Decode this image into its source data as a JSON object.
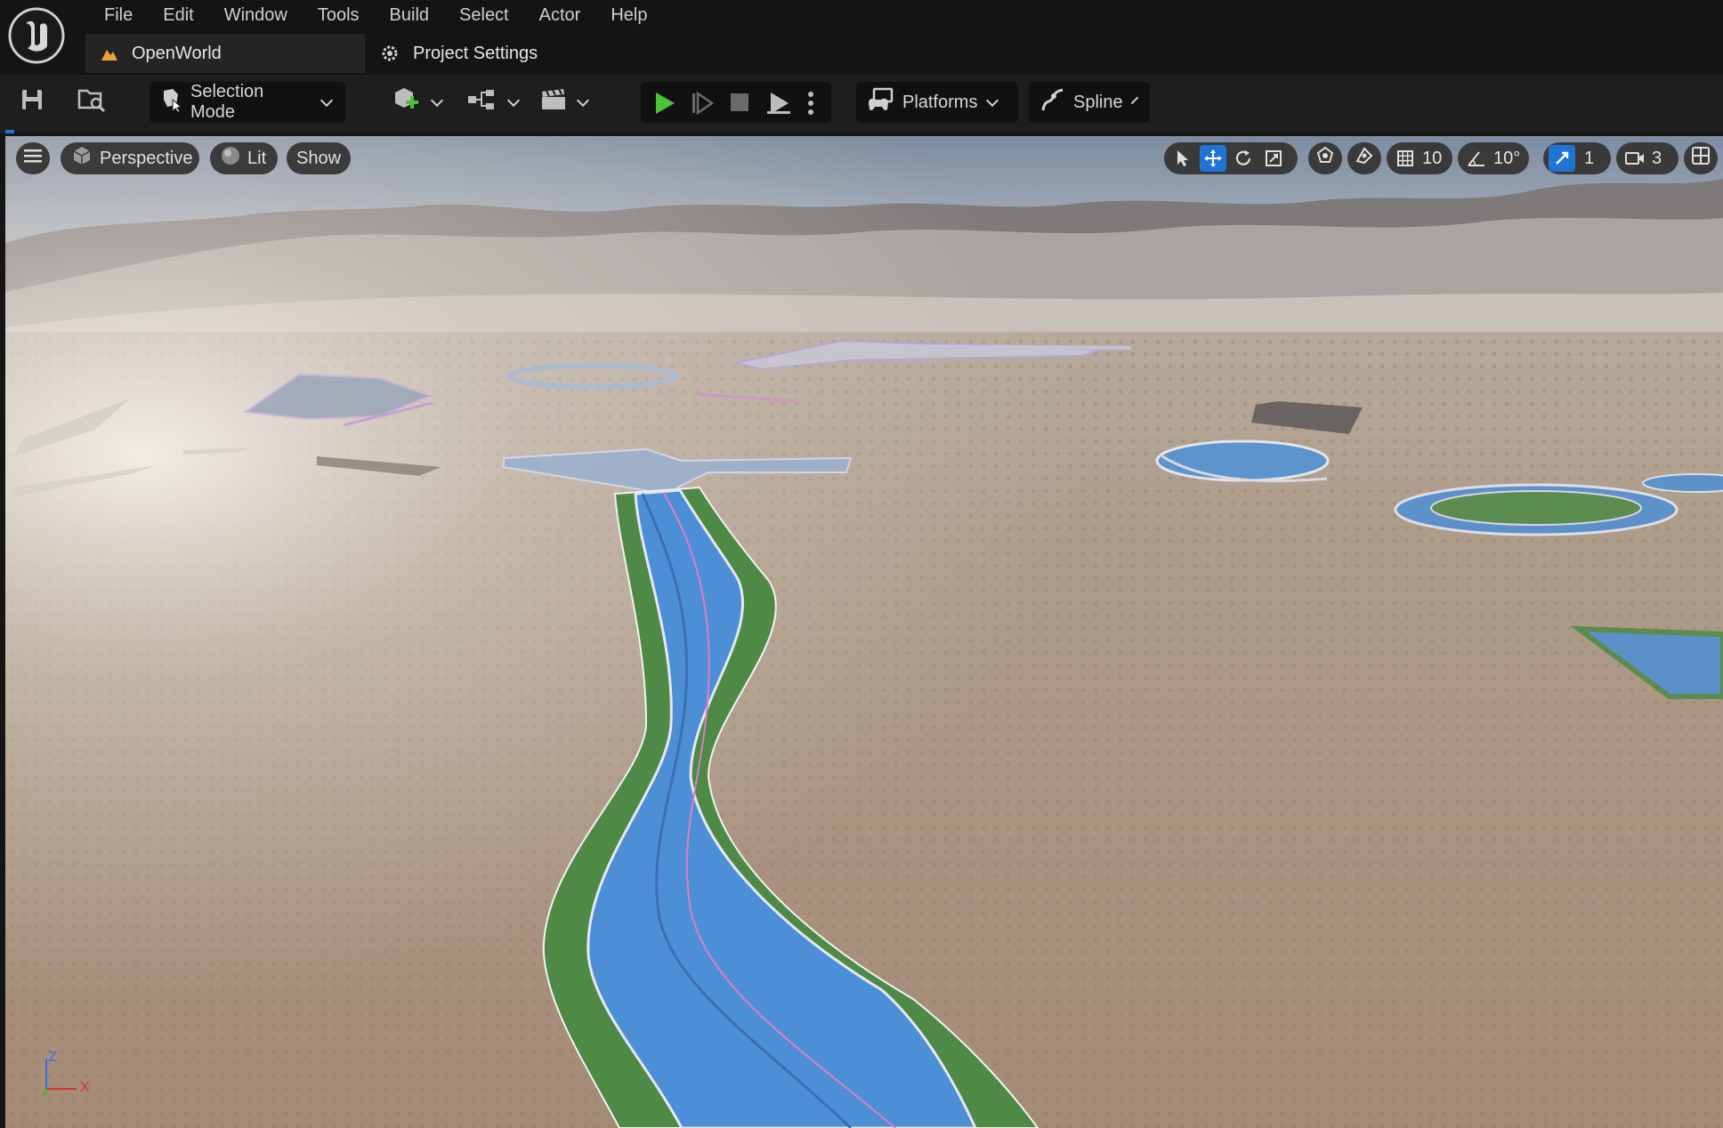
{
  "app": {
    "name": "Unreal Editor"
  },
  "menu": [
    "File",
    "Edit",
    "Window",
    "Tools",
    "Build",
    "Select",
    "Actor",
    "Help"
  ],
  "tabs": [
    {
      "label": "OpenWorld",
      "icon": "level-icon",
      "active": true
    },
    {
      "label": "Project Settings",
      "icon": "settings-gear-icon",
      "active": false
    }
  ],
  "toolbar": {
    "save_icon": "save-icon",
    "browse_icon": "content-browser-icon",
    "mode": {
      "label": "Selection Mode",
      "icon": "selection-mode-icon"
    },
    "add_icon": "add-actor-icon",
    "blueprint_icon": "blueprint-icon",
    "cinematics_icon": "clapperboard-icon",
    "play_icons": [
      "play-icon",
      "advance-frame-icon",
      "stop-icon",
      "simulate-icon",
      "more-options-icon"
    ],
    "platforms": {
      "label": "Platforms",
      "icon": "platforms-icon"
    },
    "spline": {
      "label": "Spline",
      "icon": "spline-icon"
    }
  },
  "viewport": {
    "hamburger": "menu-icon",
    "view_mode": "Perspective",
    "lighting": "Lit",
    "show": "Show",
    "grid_snap": "10",
    "rotation_snap": "10°",
    "scale_snap": "1",
    "camera_speed": "3",
    "axis": {
      "z": "Z",
      "x": "X"
    }
  },
  "colors": {
    "accent_blue": "#1f74d4",
    "play_green": "#4cc23a",
    "road_blue": "#4d8fd6",
    "grass_green": "#4e8a45",
    "ground": "#a8927e"
  }
}
